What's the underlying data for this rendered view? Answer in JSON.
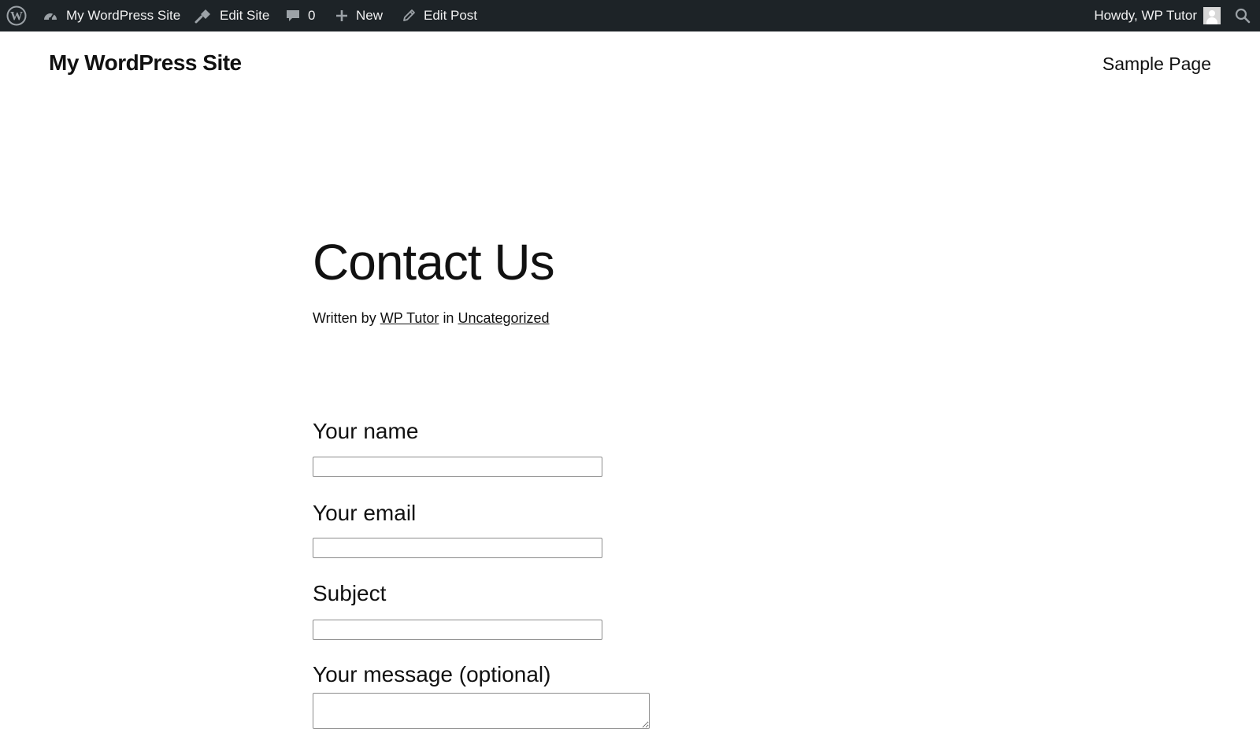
{
  "admin_bar": {
    "site_name": "My WordPress Site",
    "edit_site": "Edit Site",
    "comments_count": "0",
    "new": "New",
    "edit_post": "Edit Post",
    "howdy": "Howdy, WP Tutor",
    "background_color": "#1d2327",
    "icons": [
      "wordpress-logo-icon",
      "dashboard-icon",
      "brush-icon",
      "comment-icon",
      "plus-icon",
      "pencil-icon",
      "avatar",
      "search-icon"
    ]
  },
  "header": {
    "site_title": "My WordPress Site",
    "nav": [
      "Sample Page"
    ]
  },
  "post": {
    "title": "Contact Us",
    "byline_prefix": "Written by",
    "author": "WP Tutor",
    "byline_middle": "in",
    "category": "Uncategorized"
  },
  "form": {
    "name_label": "Your name",
    "name_value": "",
    "email_label": "Your email",
    "email_value": "",
    "subject_label": "Subject",
    "subject_value": "",
    "message_label": "Your message (optional)",
    "message_value": ""
  }
}
